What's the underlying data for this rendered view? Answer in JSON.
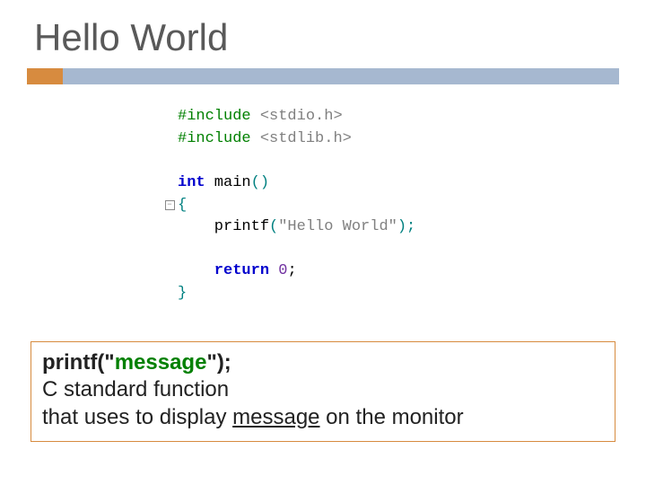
{
  "title": "Hello World",
  "code": {
    "inc1_a": "#include ",
    "inc1_b": "<stdio.h>",
    "inc2_a": "#include ",
    "inc2_b": "<stdlib.h>",
    "int": "int",
    "main": " main",
    "parens": "()",
    "lbrace": "{",
    "printf": "    printf",
    "paren_open": "(",
    "str": "\"Hello World\"",
    "paren_close_semi": ");",
    "ret": "    return",
    "zero": " 0",
    "semi": ";",
    "rbrace": "}"
  },
  "info": {
    "l1_a": "printf(\"",
    "l1_b": "message",
    "l1_c": "\");",
    "l2": "C standard function",
    "l3_a": "that uses to display ",
    "l3_b": "message",
    "l3_c": " on the monitor"
  }
}
